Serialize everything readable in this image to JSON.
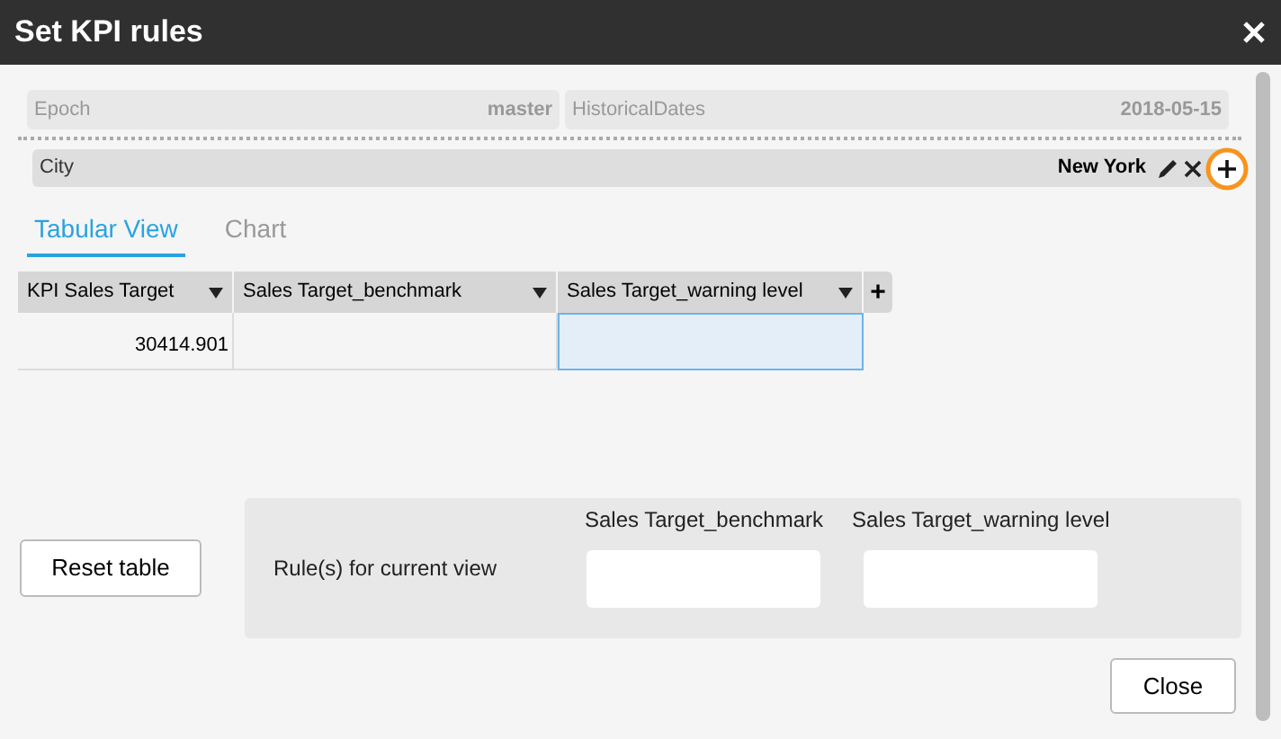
{
  "window": {
    "title": "Set KPI rules"
  },
  "filters": [
    {
      "label": "Epoch",
      "value": "master"
    },
    {
      "label": "HistoricalDates",
      "value": "2018-05-15"
    }
  ],
  "city_filter": {
    "label": "City",
    "value": "New York"
  },
  "tabs": [
    {
      "label": "Tabular View",
      "selected": true
    },
    {
      "label": "Chart",
      "selected": false
    }
  ],
  "table": {
    "columns": [
      "KPI Sales Target",
      "Sales Target_benchmark",
      "Sales Target_warning level"
    ],
    "add_column": "+",
    "rows": [
      {
        "cells": [
          {
            "text": "30414.901",
            "selected": false
          },
          {
            "text": "",
            "selected": false
          },
          {
            "text": "",
            "selected": true
          }
        ]
      }
    ]
  },
  "reset_button": "Reset table",
  "rules": {
    "label": "Rule(s) for current view",
    "fields": [
      {
        "label": "Sales Target_benchmark"
      },
      {
        "label": "Sales Target_warning level"
      }
    ]
  },
  "close_button": "Close"
}
